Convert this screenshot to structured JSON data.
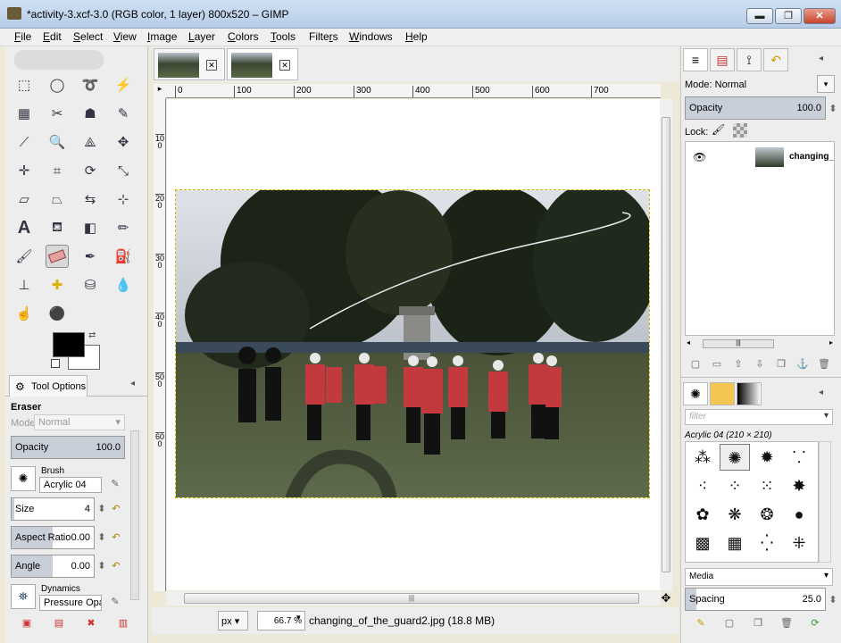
{
  "window": {
    "title": "*activity-3.xcf-3.0 (RGB color, 1 layer) 800x520 – GIMP",
    "minimize": "▬",
    "maximize": "❐",
    "close": "✕"
  },
  "menubar": [
    "File",
    "Edit",
    "Select",
    "View",
    "Image",
    "Layer",
    "Colors",
    "Tools",
    "Filters",
    "Windows",
    "Help"
  ],
  "menubar_mnemonic": [
    "F",
    "E",
    "S",
    "V",
    "I",
    "L",
    "C",
    "T",
    "r",
    "W",
    "H"
  ],
  "toolbox": {
    "tool_options_tab": "Tool Options",
    "tool_name": "Eraser",
    "mode_label": "Mode:",
    "mode_value": "Normal",
    "opacity_label": "Opacity",
    "opacity_value": "100.0",
    "brush_label": "Brush",
    "brush_value": "Acrylic 04",
    "size_label": "Size",
    "size_value": "4",
    "aspect_label": "Aspect Ratio",
    "aspect_value": "0.00",
    "angle_label": "Angle",
    "angle_value": "0.00",
    "dynamics_label": "Dynamics",
    "dynamics_value": "Pressure Opac"
  },
  "image_tabs": [
    {
      "active": false
    },
    {
      "active": true
    }
  ],
  "ruler_h": [
    "0",
    "100",
    "200",
    "300",
    "400",
    "500",
    "600",
    "700"
  ],
  "ruler_v": [
    "100",
    "200",
    "300",
    "400",
    "500",
    "600"
  ],
  "status": {
    "unit": "px",
    "zoom": "66.7 %",
    "info": "changing_of_the_guard2.jpg (18.8 MB)"
  },
  "layers": {
    "mode_label": "Mode:",
    "mode_value": "Normal",
    "opacity_label": "Opacity",
    "opacity_value": "100.0",
    "lock_label": "Lock:",
    "layer_name": "changing_"
  },
  "brushes": {
    "filter_placeholder": "filter",
    "selected": "Acrylic 04 (210 × 210)",
    "media": "Media",
    "spacing_label": "Spacing",
    "spacing_value": "25.0"
  }
}
